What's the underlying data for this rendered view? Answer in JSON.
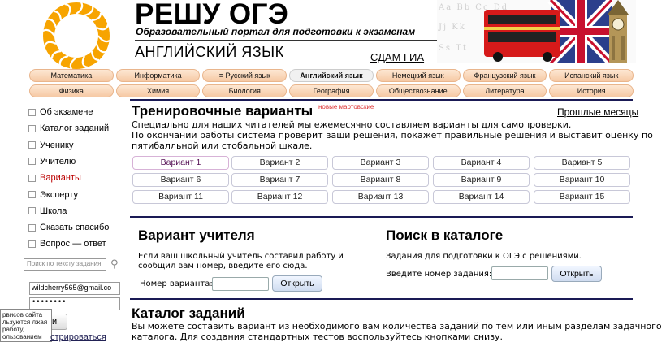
{
  "header": {
    "title": "РЕШУ ОГЭ",
    "subtitle": "Образовательный портал для подготовки к экзаменам",
    "subject": "АНГЛИЙСКИЙ ЯЗЫК",
    "gia_link": "СДАМ ГИА",
    "banner_letters": [
      "Aa Bb Cc Dd",
      "Jj Kk",
      "Ss Tt"
    ]
  },
  "nav_row1": [
    "Математика",
    "Информатика",
    "≡ Русский язык",
    "Английский язык",
    "Немецкий язык",
    "Французский язык",
    "Испанский язык"
  ],
  "nav_row1_active": 3,
  "nav_row2": [
    "Физика",
    "Химия",
    "Биология",
    "География",
    "Обществознание",
    "Литература",
    "История"
  ],
  "sidebar": {
    "items": [
      "Об экзамене",
      "Каталог заданий",
      "Ученику",
      "Учителю",
      "Варианты",
      "Эксперту",
      "Школа",
      "Сказать спасибо",
      "Вопрос — ответ"
    ],
    "selected_index": 4,
    "search_placeholder": "Поиск по тексту задания",
    "email_value": "wildcherry565@gmail.co",
    "password_value": "••••••••",
    "popup_text": "рвисов сайта льзуются лжая работу, ользованием",
    "login_button": "и",
    "register_link": "стрироваться"
  },
  "training": {
    "title": "Тренировочные варианты",
    "badge": "новые мартовские",
    "past_link": "Прошлые месяцы",
    "desc_line1": "Специально для наших читателей мы ежемесячно составляем варианты для самопроверки.",
    "desc_line2": "По окончании работы система проверит ваши решения, покажет правильные решения и выставит оценку по",
    "desc_line3": "пятибалльной или стобальной шкале.",
    "variants": [
      "Вариант 1",
      "Вариант 2",
      "Вариант 3",
      "Вариант 4",
      "Вариант 5",
      "Вариант 6",
      "Вариант 7",
      "Вариант 8",
      "Вариант 9",
      "Вариант 10",
      "Вариант 11",
      "Вариант 12",
      "Вариант 13",
      "Вариант 14",
      "Вариант 15"
    ]
  },
  "teacher": {
    "title": "Вариант учителя",
    "desc_line1": "Если ваш школьный учитель составил работу и",
    "desc_line2": "сообщил вам номер, введите его сюда.",
    "label": "Номер варианта:",
    "button": "Открыть"
  },
  "catalog_search": {
    "title": "Поиск в каталоге",
    "desc": "Задания для подготовки к ОГЭ с решениями.",
    "label": "Введите номер задания:",
    "button": "Открыть"
  },
  "catalog": {
    "title": "Каталог заданий",
    "desc_line1": "Вы можете составить вариант из необходимого вам количества заданий по тем или иным разделам задачного",
    "desc_line2": "каталога. Для создания стандартных тестов воспользуйтесь кнопками снизу."
  },
  "colors": {
    "tab_bg": "#f6c9a4",
    "rule": "#1a1a55",
    "selected_link": "#bb0000",
    "badge": "#dd3333"
  }
}
